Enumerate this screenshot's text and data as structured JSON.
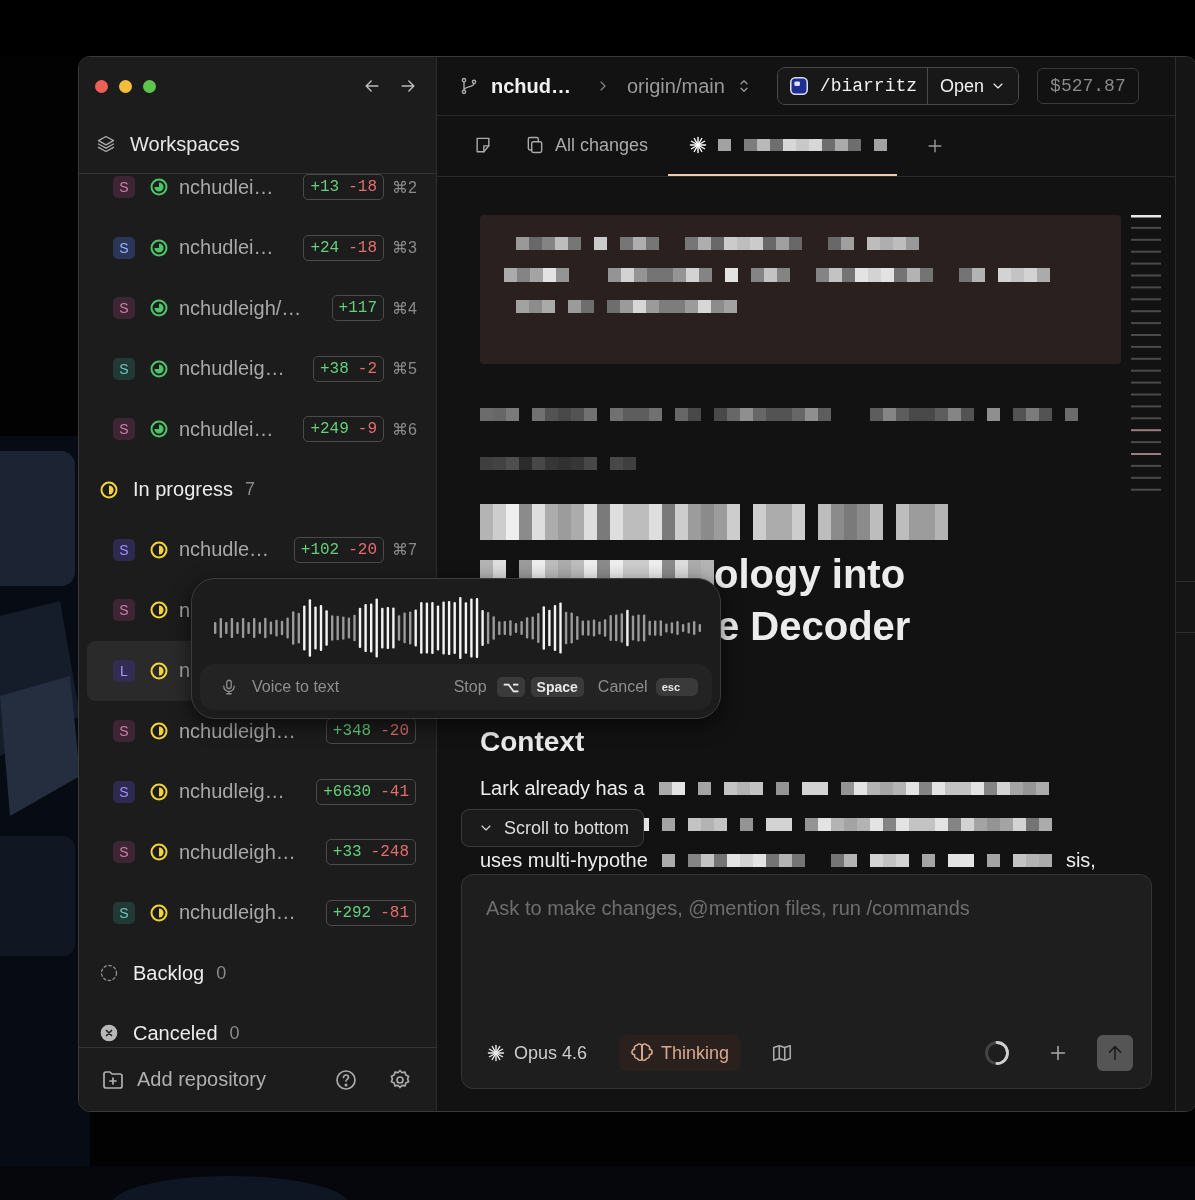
{
  "sidebar": {
    "title": "Workspaces",
    "sections": [
      {
        "rows": [
          {
            "avatar": "S",
            "color": "#3d2533",
            "kind": "done",
            "name": "nchudlei…",
            "added": "+13",
            "removed": "-18",
            "shortcut": "⌘2",
            "selected": false
          },
          {
            "avatar": "S",
            "color": "#2b3558",
            "kind": "done",
            "name": "nchudlei…",
            "added": "+24",
            "removed": "-18",
            "shortcut": "⌘3",
            "selected": false
          },
          {
            "avatar": "S",
            "color": "#3d2533",
            "kind": "done",
            "name": "nchudleigh/…",
            "added": "+117",
            "shortcut": "⌘4",
            "selected": false
          },
          {
            "avatar": "S",
            "color": "#213a36",
            "kind": "done",
            "name": "nchudleig…",
            "added": "+38",
            "removed": "-2",
            "shortcut": "⌘5",
            "selected": false
          },
          {
            "avatar": "S",
            "color": "#3d2533",
            "kind": "done",
            "name": "nchudlei…",
            "added": "+249",
            "removed": "-9",
            "shortcut": "⌘6",
            "selected": false
          }
        ]
      },
      {
        "kind": "in_progress",
        "title": "In progress",
        "count": "7",
        "rows": [
          {
            "avatar": "S",
            "color": "#2e2a4f",
            "kind": "in_progress",
            "name": "nchudle…",
            "added": "+102",
            "removed": "-20",
            "shortcut": "⌘7",
            "selected": false
          },
          {
            "avatar": "S",
            "color": "#3d2533",
            "kind": "in_progress",
            "name": "n",
            "selected": false
          },
          {
            "avatar": "L",
            "color": "#322b52",
            "kind": "in_progress",
            "name": "n",
            "selected": true
          },
          {
            "avatar": "S",
            "color": "#3d2533",
            "kind": "in_progress",
            "name": "nchudleigh…",
            "added": "+348",
            "removed": "-20",
            "selected": false
          },
          {
            "avatar": "S",
            "color": "#2e2a4f",
            "kind": "in_progress",
            "name": "nchudleig…",
            "added": "+6630",
            "removed": "-41",
            "selected": false
          },
          {
            "avatar": "S",
            "color": "#3d2533",
            "kind": "in_progress",
            "name": "nchudleigh…",
            "added": "+33",
            "removed": "-248",
            "selected": false
          },
          {
            "avatar": "S",
            "color": "#213a36",
            "kind": "in_progress",
            "name": "nchudleigh…",
            "added": "+292",
            "removed": "-81",
            "selected": false
          }
        ]
      },
      {
        "kind": "backlog",
        "title": "Backlog",
        "count": "0"
      },
      {
        "kind": "canceled",
        "title": "Canceled",
        "count": "0"
      }
    ],
    "footer": {
      "add_label": "Add repository"
    }
  },
  "header": {
    "repo": "nchud…",
    "branch": "origin/main",
    "path": "/biarritz",
    "open_label": "Open",
    "cost": "$527.87"
  },
  "tabs": [
    {
      "kind": "notes",
      "selected": false
    },
    {
      "kind": "changes",
      "label": "All changes",
      "selected": false
    },
    {
      "kind": "chat",
      "selected": true
    }
  ],
  "document": {
    "blocks": [
      {
        "kind": "callout"
      },
      {
        "kind": "redacted_paragraph"
      },
      {
        "kind": "heading",
        "lines": [
          [
            {
              "kind": "redacted"
            }
          ],
          [
            {
              "kind": "redacted"
            },
            {
              "kind": "text",
              "text": "ology into"
            }
          ],
          [
            {
              "kind": "covered"
            },
            {
              "kind": "text",
              "text": "e Decoder"
            }
          ]
        ]
      },
      {
        "kind": "subheading",
        "text": "Context"
      },
      {
        "kind": "paragraph",
        "lines": [
          [
            {
              "kind": "text",
              "text": "Lark already has a"
            },
            {
              "kind": "redacted"
            }
          ],
          [
            {
              "kind": "redacted"
            }
          ],
          [
            {
              "kind": "text",
              "text": "uses multi-hypothe"
            },
            {
              "kind": "redacted"
            },
            {
              "kind": "text",
              "text": "sis,"
            }
          ]
        ]
      }
    ]
  },
  "scroll_button": {
    "label": "Scroll to bottom"
  },
  "composer": {
    "placeholder": "Ask to make changes, @mention files, run /commands",
    "model": "Opus 4.6",
    "thinking": {
      "label": "Thinking",
      "on": true
    }
  },
  "voice_popup": {
    "label": "Voice to text",
    "stop_label": "Stop",
    "stop_keys": [
      "⌥",
      "Space"
    ],
    "cancel_label": "Cancel",
    "cancel_key": "esc"
  }
}
